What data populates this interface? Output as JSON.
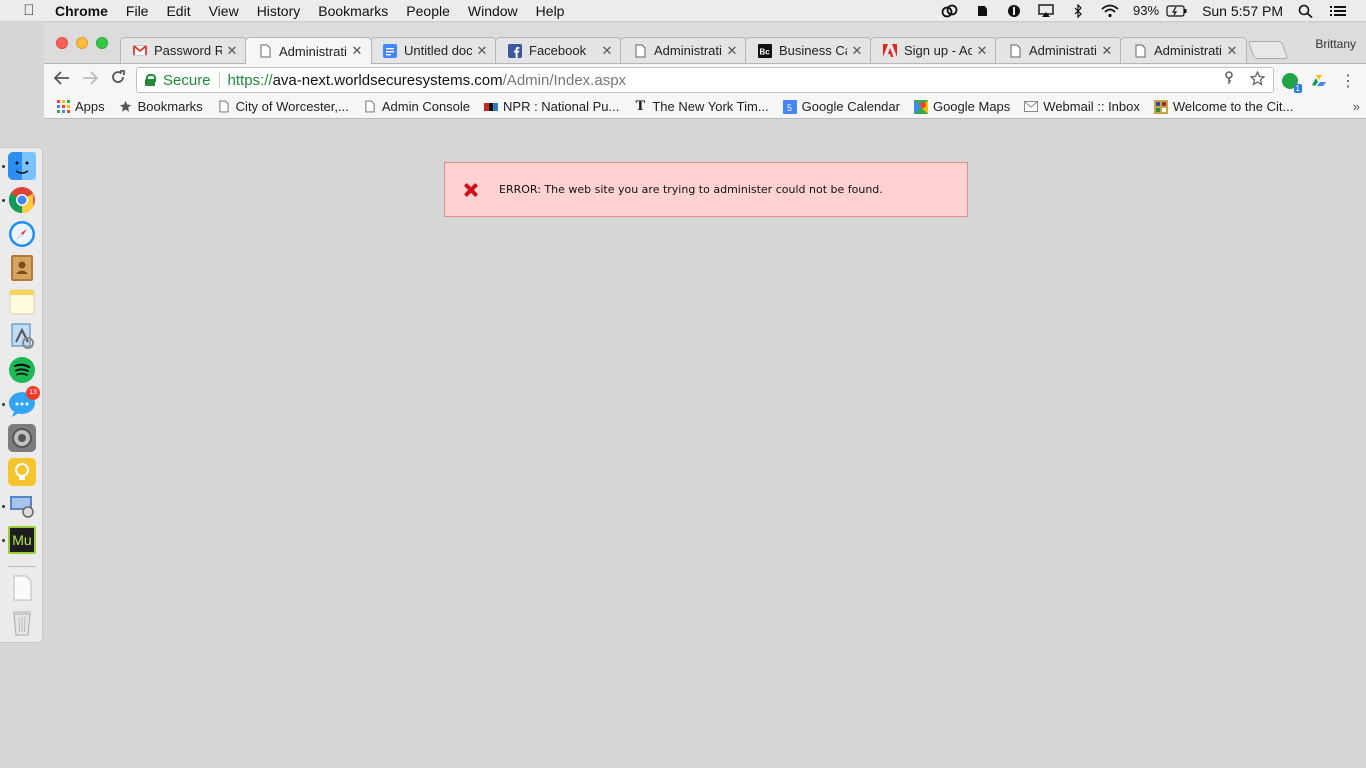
{
  "menubar": {
    "app_name": "Chrome",
    "items": [
      "File",
      "Edit",
      "View",
      "History",
      "Bookmarks",
      "People",
      "Window",
      "Help"
    ],
    "battery": "93%",
    "clock": "Sun 5:57 PM",
    "status_icons": [
      "creative-cloud-icon",
      "evernote-icon",
      "1password-icon",
      "airplay-icon",
      "bluetooth-icon",
      "wifi-icon",
      "battery-icon",
      "spotlight-icon",
      "notification-center-icon"
    ]
  },
  "window": {
    "profile_name": "Brittany",
    "tabs": [
      {
        "title": "Password Re",
        "icon": "gmail-icon",
        "active": false
      },
      {
        "title": "Administratic",
        "icon": "page-icon",
        "active": true
      },
      {
        "title": "Untitled doc",
        "icon": "google-docs-icon",
        "active": false
      },
      {
        "title": "Facebook",
        "icon": "facebook-icon",
        "active": false
      },
      {
        "title": "Administratic",
        "icon": "page-icon",
        "active": false
      },
      {
        "title": "Business Ca",
        "icon": "bc-icon",
        "active": false
      },
      {
        "title": "Sign up - Ad",
        "icon": "adobe-icon",
        "active": false
      },
      {
        "title": "Administratic",
        "icon": "page-icon",
        "active": false
      },
      {
        "title": "Administratic",
        "icon": "page-icon",
        "active": false
      }
    ],
    "address": {
      "secure_label": "Secure",
      "scheme": "https://",
      "host": "ava-next.worldsecuresystems.com",
      "path": "/Admin/Index.aspx"
    },
    "bookmarks": [
      {
        "label": "Apps",
        "icon": "apps-grid-icon"
      },
      {
        "label": "Bookmarks",
        "icon": "star-icon"
      },
      {
        "label": "City of Worcester,...",
        "icon": "page-icon"
      },
      {
        "label": "Admin Console",
        "icon": "page-icon"
      },
      {
        "label": "NPR : National Pu...",
        "icon": "npr-icon"
      },
      {
        "label": "The New York Tim...",
        "icon": "nyt-icon"
      },
      {
        "label": "Google Calendar",
        "icon": "google-calendar-icon"
      },
      {
        "label": "Google Maps",
        "icon": "google-maps-icon"
      },
      {
        "label": "Webmail :: Inbox",
        "icon": "mail-icon"
      },
      {
        "label": "Welcome to the Cit...",
        "icon": "city-icon"
      }
    ],
    "bookmarks_overflow": "»"
  },
  "page": {
    "error_message": "ERROR: The web site you are trying to administer could not be found."
  },
  "dock": {
    "items": [
      "finder-icon",
      "chrome-icon",
      "safari-icon",
      "contacts-icon",
      "notes-icon",
      "preview-icon",
      "spotify-icon",
      "messages-icon",
      "system-preferences-icon",
      "tips-icon",
      "image-capture-icon",
      "muse-icon",
      "documents-icon",
      "trash-icon"
    ],
    "messages_badge": "13",
    "muse_label": "Mu"
  },
  "colors": {
    "error_bg": "#ffd2d2",
    "error_border": "#e88c8c",
    "secure_green": "#1f8b38"
  }
}
